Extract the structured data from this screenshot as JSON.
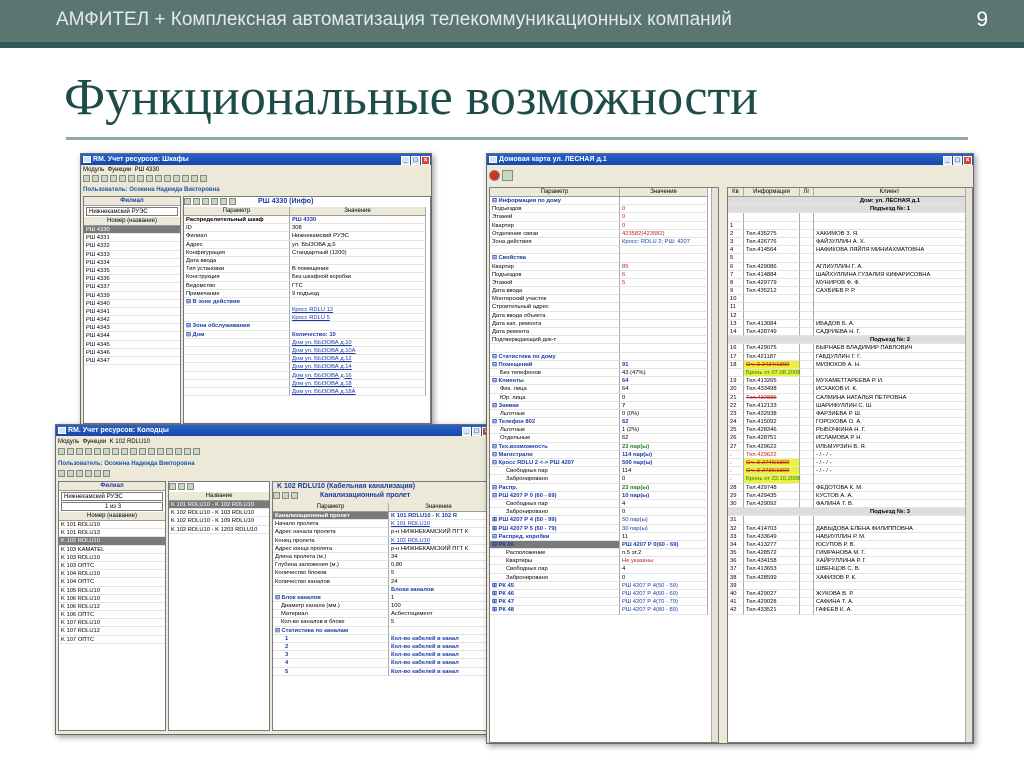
{
  "header": {
    "title": "АМФИТЕЛ + Комплексная автоматизация телекоммуникационных компаний",
    "slide_number": "9"
  },
  "slide_title": "Функциональные возможности",
  "w1": {
    "title": "RM. Учет ресурсов: Шкафы",
    "menu": [
      "Модуль",
      "Функции",
      "РШ 4330"
    ],
    "user": "Пользователь: Осокина Надежда Викторовна",
    "panel_title": "РШ 4330 (Инфо)",
    "filial_label": "Филиал",
    "filial_value": "Нижнекамский РУЭС",
    "list_header": "Номер (название)",
    "list": [
      "РШ 4330",
      "РШ 4331",
      "РШ 4332",
      "РШ 4333",
      "РШ 4334",
      "РШ 4335",
      "РШ 4336",
      "РШ 4337",
      "РШ 4339",
      "РШ 4340",
      "РШ 4341",
      "РШ 4342",
      "РШ 4343",
      "РШ 4344",
      "РШ 4345",
      "РШ 4346",
      "РШ 4347"
    ],
    "param_header": "Параметр",
    "value_header": "Значение",
    "rows": [
      [
        "Распределительный шкаф",
        "РШ 4330"
      ],
      [
        "ID",
        "308"
      ],
      [
        "Филиал",
        "Нижнекамский РУЭС"
      ],
      [
        "Адрес",
        "ул. БЫЗОВА д.6"
      ],
      [
        "Конфигурация",
        "Стандартный (1200)"
      ],
      [
        "Дата ввода",
        ""
      ],
      [
        "Тип установки",
        "В помещении"
      ],
      [
        "Конструкция",
        "Без шкафной коробки"
      ],
      [
        "Ведомство",
        "ГТС"
      ],
      [
        "Примечание",
        "9 подъезд"
      ],
      [
        "⊟ В зоне действия",
        ""
      ],
      [
        "",
        "Кросс RDLU 12"
      ],
      [
        "",
        "Кросс RDLU 5"
      ],
      [
        "⊟ Зона обслуживания",
        ""
      ],
      [
        "⊟ Дом",
        "Количество: 10"
      ],
      [
        "",
        "Дом ул. БЫЗОВА д.10"
      ],
      [
        "",
        "Дом ул. БЫЗОВА д.10А"
      ],
      [
        "",
        "Дом ул. БЫЗОВА д.12"
      ],
      [
        "",
        "Дом ул. БЫЗОВА д.14"
      ],
      [
        "",
        "Дом ул. БЫЗОВА д.16"
      ],
      [
        "",
        "Дом ул. БЫЗОВА д.18"
      ],
      [
        "",
        "Дом ул. БЫЗОВА д.18А"
      ]
    ]
  },
  "w2": {
    "title": "RM. Учет ресурсов: Колодцы",
    "menu": [
      "Модуль",
      "Функции",
      "K 102 RDLU10"
    ],
    "user": "Пользователь: Осокина Надежда Викторовна",
    "filial_label": "Филиал",
    "filial_value": "Нижнекамский РУЭС",
    "pager": "1 из 3",
    "list_header": "Номер (название)",
    "list": [
      "K 101 RDLU10",
      "K 101 RDLU13",
      "K 102 RDLU10",
      "K 103 KAMATEL",
      "K 103 RDLU10",
      "K 103 ОПТС",
      "K 104 RDLU10",
      "K 104 ОПТС",
      "K 105 RDLU10",
      "K 106 RDLU10",
      "K 106 RDLU12",
      "K 106 ОПТС",
      "K 107 RDLU10",
      "K 107 RDLU12",
      "K 107 ОПТС"
    ],
    "name_header": "Название",
    "names": [
      "K 101 RDLU10 - K 102 RDLU10",
      "K 102 RDLU10 - K 103 RDLU10",
      "K 102 RDLU10 - K 109 RDLU10",
      "K 102 RDLU10 - K 1203 RDLU10"
    ],
    "panel_title": "K 102 RDLU10 (Кабельная канализация)",
    "sub_title": "Канализационный пролет",
    "param_header": "Параметр",
    "value_header": "Значение",
    "rows": [
      [
        "Канализационный пролет",
        "K 101 RDLU10 - K 102 R"
      ],
      [
        "Начало пролета",
        "K 101 RDLU10"
      ],
      [
        "Адрес начала пролета",
        "р-н НИЖНЕКАМСКИЙ ПГТ К"
      ],
      [
        "Конец пролета",
        "K 102 RDLU10"
      ],
      [
        "Адрес конца пролета",
        "р-н НИЖНЕКАМСКИЙ ПГТ К"
      ],
      [
        "Длина пролета (м.)",
        "34"
      ],
      [
        "Глубина заложения (м.)",
        "0,80"
      ],
      [
        "Количество блоков",
        "5"
      ],
      [
        "Количество каналов",
        "24"
      ],
      [
        "",
        "Блоки каналов"
      ],
      [
        "⊟ Блок каналов",
        "1"
      ],
      [
        "Диаметр канала (мм.)",
        "100"
      ],
      [
        "Материал",
        "Асбестоцемент"
      ],
      [
        "Кол-во каналов в блоке",
        "5"
      ],
      [
        "⊟ Статистика по каналам",
        ""
      ],
      [
        "1",
        "Кол-во кабелей в канал"
      ],
      [
        "2",
        "Кол-во кабелей в канал"
      ],
      [
        "3",
        "Кол-во кабелей в канал"
      ],
      [
        "4",
        "Кол-во кабелей в канал"
      ],
      [
        "5",
        "Кол-во кабелей в канал"
      ]
    ]
  },
  "w3": {
    "title": "Домовая карта  ул. ЛЕСНАЯ д.1",
    "param_header": "Параметр",
    "value_header": "Значение",
    "rows": [
      [
        "⊟ Информация по дому",
        ""
      ],
      [
        "Подъездов",
        "0"
      ],
      [
        "Этажей",
        "0"
      ],
      [
        "Квартир",
        "0"
      ],
      [
        "Отделение связи",
        "423582(423582)"
      ],
      [
        "Зона действия",
        "Кросс: RDLU 2; РШ: 4207"
      ],
      [
        "",
        ""
      ],
      [
        "⊟ Свойства",
        ""
      ],
      [
        "Квартир",
        "85"
      ],
      [
        "Подъездов",
        "6"
      ],
      [
        "Этажей",
        "5"
      ],
      [
        "Дата ввода",
        ""
      ],
      [
        "Монтерский участок",
        ""
      ],
      [
        "Строительный адрес",
        ""
      ],
      [
        "Дата ввода объекта",
        ""
      ],
      [
        "Дата кап. ремонта",
        ""
      ],
      [
        "Дата ремонта",
        ""
      ],
      [
        "Подтверждающий док-т",
        ""
      ],
      [
        "",
        ""
      ],
      [
        "⊟ Статистика по дому",
        ""
      ],
      [
        "⊟ Помещений",
        "91"
      ],
      [
        "Без телефонов",
        "43 (47%)"
      ],
      [
        "⊟ Клиенты",
        "64"
      ],
      [
        "Физ. лица",
        "64"
      ],
      [
        "Юр. лица",
        "0"
      ],
      [
        "⊟ Заявки",
        "7"
      ],
      [
        "Льготные",
        "0 (0%)"
      ],
      [
        "⊟ Телефон 802",
        "62"
      ],
      [
        "Льготные",
        "1 (2%)"
      ],
      [
        "Отдельные",
        "62"
      ],
      [
        "⊟ Тех.возможность",
        "23 пар(ы)"
      ],
      [
        "⊟ Магистрали",
        "114 пар(ы)"
      ],
      [
        "⊟ Кросс RDLU 2 <-> РШ 4207",
        "500 пар(ы)"
      ],
      [
        "Свободных пар",
        "114"
      ],
      [
        "Забронировано",
        "0"
      ],
      [
        "⊟ Распр.",
        "23 пар(ы)"
      ],
      [
        "⊟ РШ 4207 Р 0 (60 - 69)",
        "10 пар(ы)"
      ],
      [
        "Свободных пар",
        "4"
      ],
      [
        "Забронировано",
        "0"
      ],
      [
        "⊞ РШ 4207 Р 4 (50 - 99)",
        "50 пар(ы)"
      ],
      [
        "⊞ РШ 4207 Р 5 (50 - 79)",
        "30 пар(ы)"
      ],
      [
        "⊟ Распред. коробки",
        "11"
      ],
      [
        "⊟ РК 06",
        "РШ 4207 Р 0(60 - 69)"
      ],
      [
        "Расположение",
        "п.5 эт.2"
      ],
      [
        "Квартиры",
        "Не указаны"
      ],
      [
        "Свободных пар",
        "4"
      ],
      [
        "Забронировано",
        "0"
      ],
      [
        "⊞ РК 45",
        "РШ 4207 Р 4(50 - 59)"
      ],
      [
        "⊞ РК 46",
        "РШ 4207 Р 4(60 - 69)"
      ],
      [
        "⊞ РК 47",
        "РШ 4207 Р 4(70 - 79)"
      ],
      [
        "⊞ РК 48",
        "РШ 4207 Р 4(80 - 89)"
      ]
    ],
    "right_headers": [
      "Кв",
      "Информация",
      "Лг",
      "Клиент"
    ],
    "house": "Дом: ул. ЛЕСНАЯ д.1",
    "podezd1": "Подъезд №: 1",
    "podezd2": "Подъезд №: 2",
    "podezd3": "Подъезд №: 3",
    "rrows": [
      [
        "",
        "",
        "",
        ""
      ],
      [
        "1",
        "",
        "",
        ""
      ],
      [
        "2",
        "Тел.435275",
        "",
        "ХАКИМОВ З. Я."
      ],
      [
        "3",
        "Тел.426776",
        "",
        "ФАЙЗУЛЛИН А. Х."
      ],
      [
        "4",
        "Тел.414564",
        "",
        "НАФИКОВА ЛЯЙЛЯ МИНИАХМАТОВНА"
      ],
      [
        "5",
        "",
        "",
        ""
      ],
      [
        "6",
        "Тел.429086",
        "",
        "АГЛИУЛЛИН Г. А."
      ],
      [
        "7",
        "Тел.414884",
        "",
        "ШАЙХУЛЛИНА ГУЗАЛИЯ КИФАРИСОВНА"
      ],
      [
        "8",
        "Тел.429779",
        "",
        "МУНИРОВ Ф. Ф."
      ],
      [
        "9",
        "Тел.435212",
        "",
        "САХБИЕВ Р. Р."
      ],
      [
        "10",
        "",
        "",
        ""
      ],
      [
        "11",
        "",
        "",
        ""
      ],
      [
        "12",
        "",
        "",
        ""
      ],
      [
        "13",
        "Тел.413084",
        "",
        "ИБАДОВ Б. А."
      ],
      [
        "14",
        "Тел.428749",
        "",
        "САДРИЕВА Н. Г."
      ],
      [
        "P2",
        "",
        "",
        ""
      ],
      [
        "16",
        "Тел.429075",
        "",
        "БЫРНАЕВ ВЛАДИМИР ПАВЛОВИЧ"
      ],
      [
        "17",
        "Тел.421187",
        "",
        "ГАБДУЛЛИН Г. Г."
      ],
      [
        "18",
        "Оч. 3-2434/1899",
        "",
        "МИЗЮКОВ А. Н."
      ],
      [
        "18b",
        "Бронь от 07.08.2008",
        "",
        ""
      ],
      [
        "19",
        "Тел.413265",
        "",
        "МУХАМЕТГАРЕЕВА Р. И."
      ],
      [
        "20",
        "Тел.433498",
        "",
        "ИСХАКОВ И. К."
      ],
      [
        "21",
        "Тел.432885",
        "",
        "САЛМИНА НАТАЛЬЯ ПЕТРОВНА"
      ],
      [
        "22",
        "Тел.412133",
        "",
        "ШАРИФУЛЛИН С. Ш."
      ],
      [
        "23",
        "Тел.432938",
        "",
        "ФАРЗИЕВА Р. Ш."
      ],
      [
        "24",
        "Тел.415092",
        "",
        "ГОРОХОВА О. А."
      ],
      [
        "25",
        "Тел.428346",
        "",
        "РЫБОЧКИНА Н. Г."
      ],
      [
        "26",
        "Тел.428751",
        "",
        "ИСЛАМОВА Р. Н."
      ],
      [
        "27",
        "Тел.429622",
        "",
        "ИЛЬМУРЗИН В. Я."
      ],
      [
        ".",
        "Тел.429622",
        "",
        "- / - / -"
      ],
      [
        "..",
        "Оч. 3-2746/1899",
        "",
        "- / - / -"
      ],
      [
        "...",
        "Оч. 3-2736/1899",
        "",
        "- / - / -"
      ],
      [
        "....",
        "Бронь от 23.10.2008",
        "",
        ""
      ],
      [
        "28",
        "Тел.429748",
        "",
        "ФЕДОТОВА К. М."
      ],
      [
        "29",
        "Тел.429435",
        "",
        "КУСТОВ А. А."
      ],
      [
        "30",
        "Тел.429092",
        "",
        "ФАЛИНА Т. В."
      ],
      [
        "P3",
        "",
        "",
        ""
      ],
      [
        "31",
        "",
        "",
        ""
      ],
      [
        "32",
        "Тел.414703",
        "",
        "ДАВЫДОВА ЕЛЕНА ФИЛИППОВНА"
      ],
      [
        "33",
        "Тел.433649",
        "",
        "НАБИУЛЛИН Р. М."
      ],
      [
        "34",
        "Тел.413277",
        "",
        "ЮСУПОВ Р. В."
      ],
      [
        "35",
        "Тел.428572",
        "",
        "ГИМРАНОВА М. Г."
      ],
      [
        "36",
        "Тел.434158",
        "",
        "ХАЙРУЛЛИНА Р. Г."
      ],
      [
        "37",
        "Тел.413653",
        "",
        "ШВЕНЦОВ С. В."
      ],
      [
        "38",
        "Тел.428599",
        "",
        "ХАФИЗОВ Р. К."
      ],
      [
        "39",
        "",
        "",
        ""
      ],
      [
        "40",
        "Тел.429027",
        "",
        "ЖУКОВА В. Р."
      ],
      [
        "41",
        "Тел.429028",
        "",
        "САФИНА Т. А."
      ],
      [
        "42",
        "Тел.433521",
        "",
        "ГАФЕЕВ К. А."
      ]
    ]
  }
}
